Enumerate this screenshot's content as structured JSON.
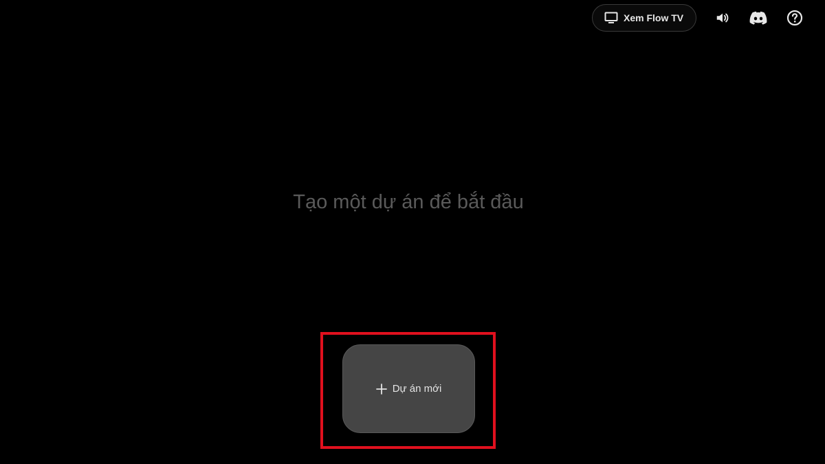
{
  "header": {
    "flow_tv_label": "Xem Flow TV",
    "icons": [
      "tv-icon",
      "volume-icon",
      "discord-icon",
      "help-icon"
    ]
  },
  "main": {
    "prompt_text": "Tạo một dự án để bắt đầu",
    "new_project_label": "Dự án mới"
  },
  "colors": {
    "background": "#000000",
    "card": "#454545",
    "highlight": "#e0101e",
    "prompt_text": "#5a5a5a"
  }
}
